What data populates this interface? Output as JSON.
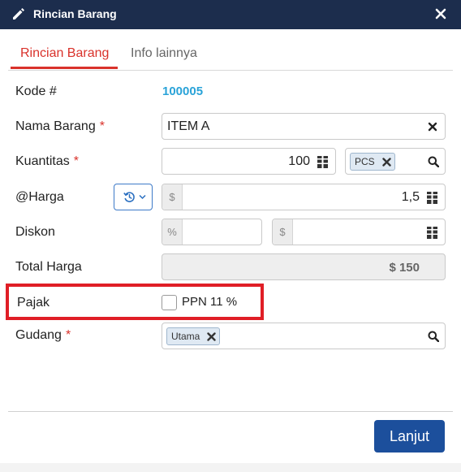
{
  "dialog": {
    "title": "Rincian Barang"
  },
  "tabs": [
    {
      "label": "Rincian Barang"
    },
    {
      "label": "Info lainnya"
    }
  ],
  "form": {
    "kode": {
      "label": "Kode #",
      "value": "100005"
    },
    "nama_barang": {
      "label": "Nama Barang",
      "required": "*",
      "value": "ITEM A"
    },
    "kuantitas": {
      "label": "Kuantitas",
      "required": "*",
      "value": "100",
      "unit": "PCS"
    },
    "harga": {
      "label": "@Harga",
      "currency": "$",
      "value": "1,5"
    },
    "diskon": {
      "label": "Diskon",
      "percent_symbol": "%",
      "currency": "$",
      "percent_value": "",
      "amount_value": ""
    },
    "total_harga": {
      "label": "Total Harga",
      "value": "$ 150"
    },
    "pajak": {
      "label": "Pajak",
      "option_label": "PPN 11 %",
      "checked": false
    },
    "gudang": {
      "label": "Gudang",
      "required": "*",
      "value": "Utama"
    }
  },
  "footer": {
    "submit_label": "Lanjut"
  },
  "colors": {
    "titlebar": "#1c2d4d",
    "accent_red": "#d9322b",
    "link_blue": "#2aa3d8",
    "primary_button": "#1c4f9c",
    "highlight_border": "#e01e26"
  }
}
